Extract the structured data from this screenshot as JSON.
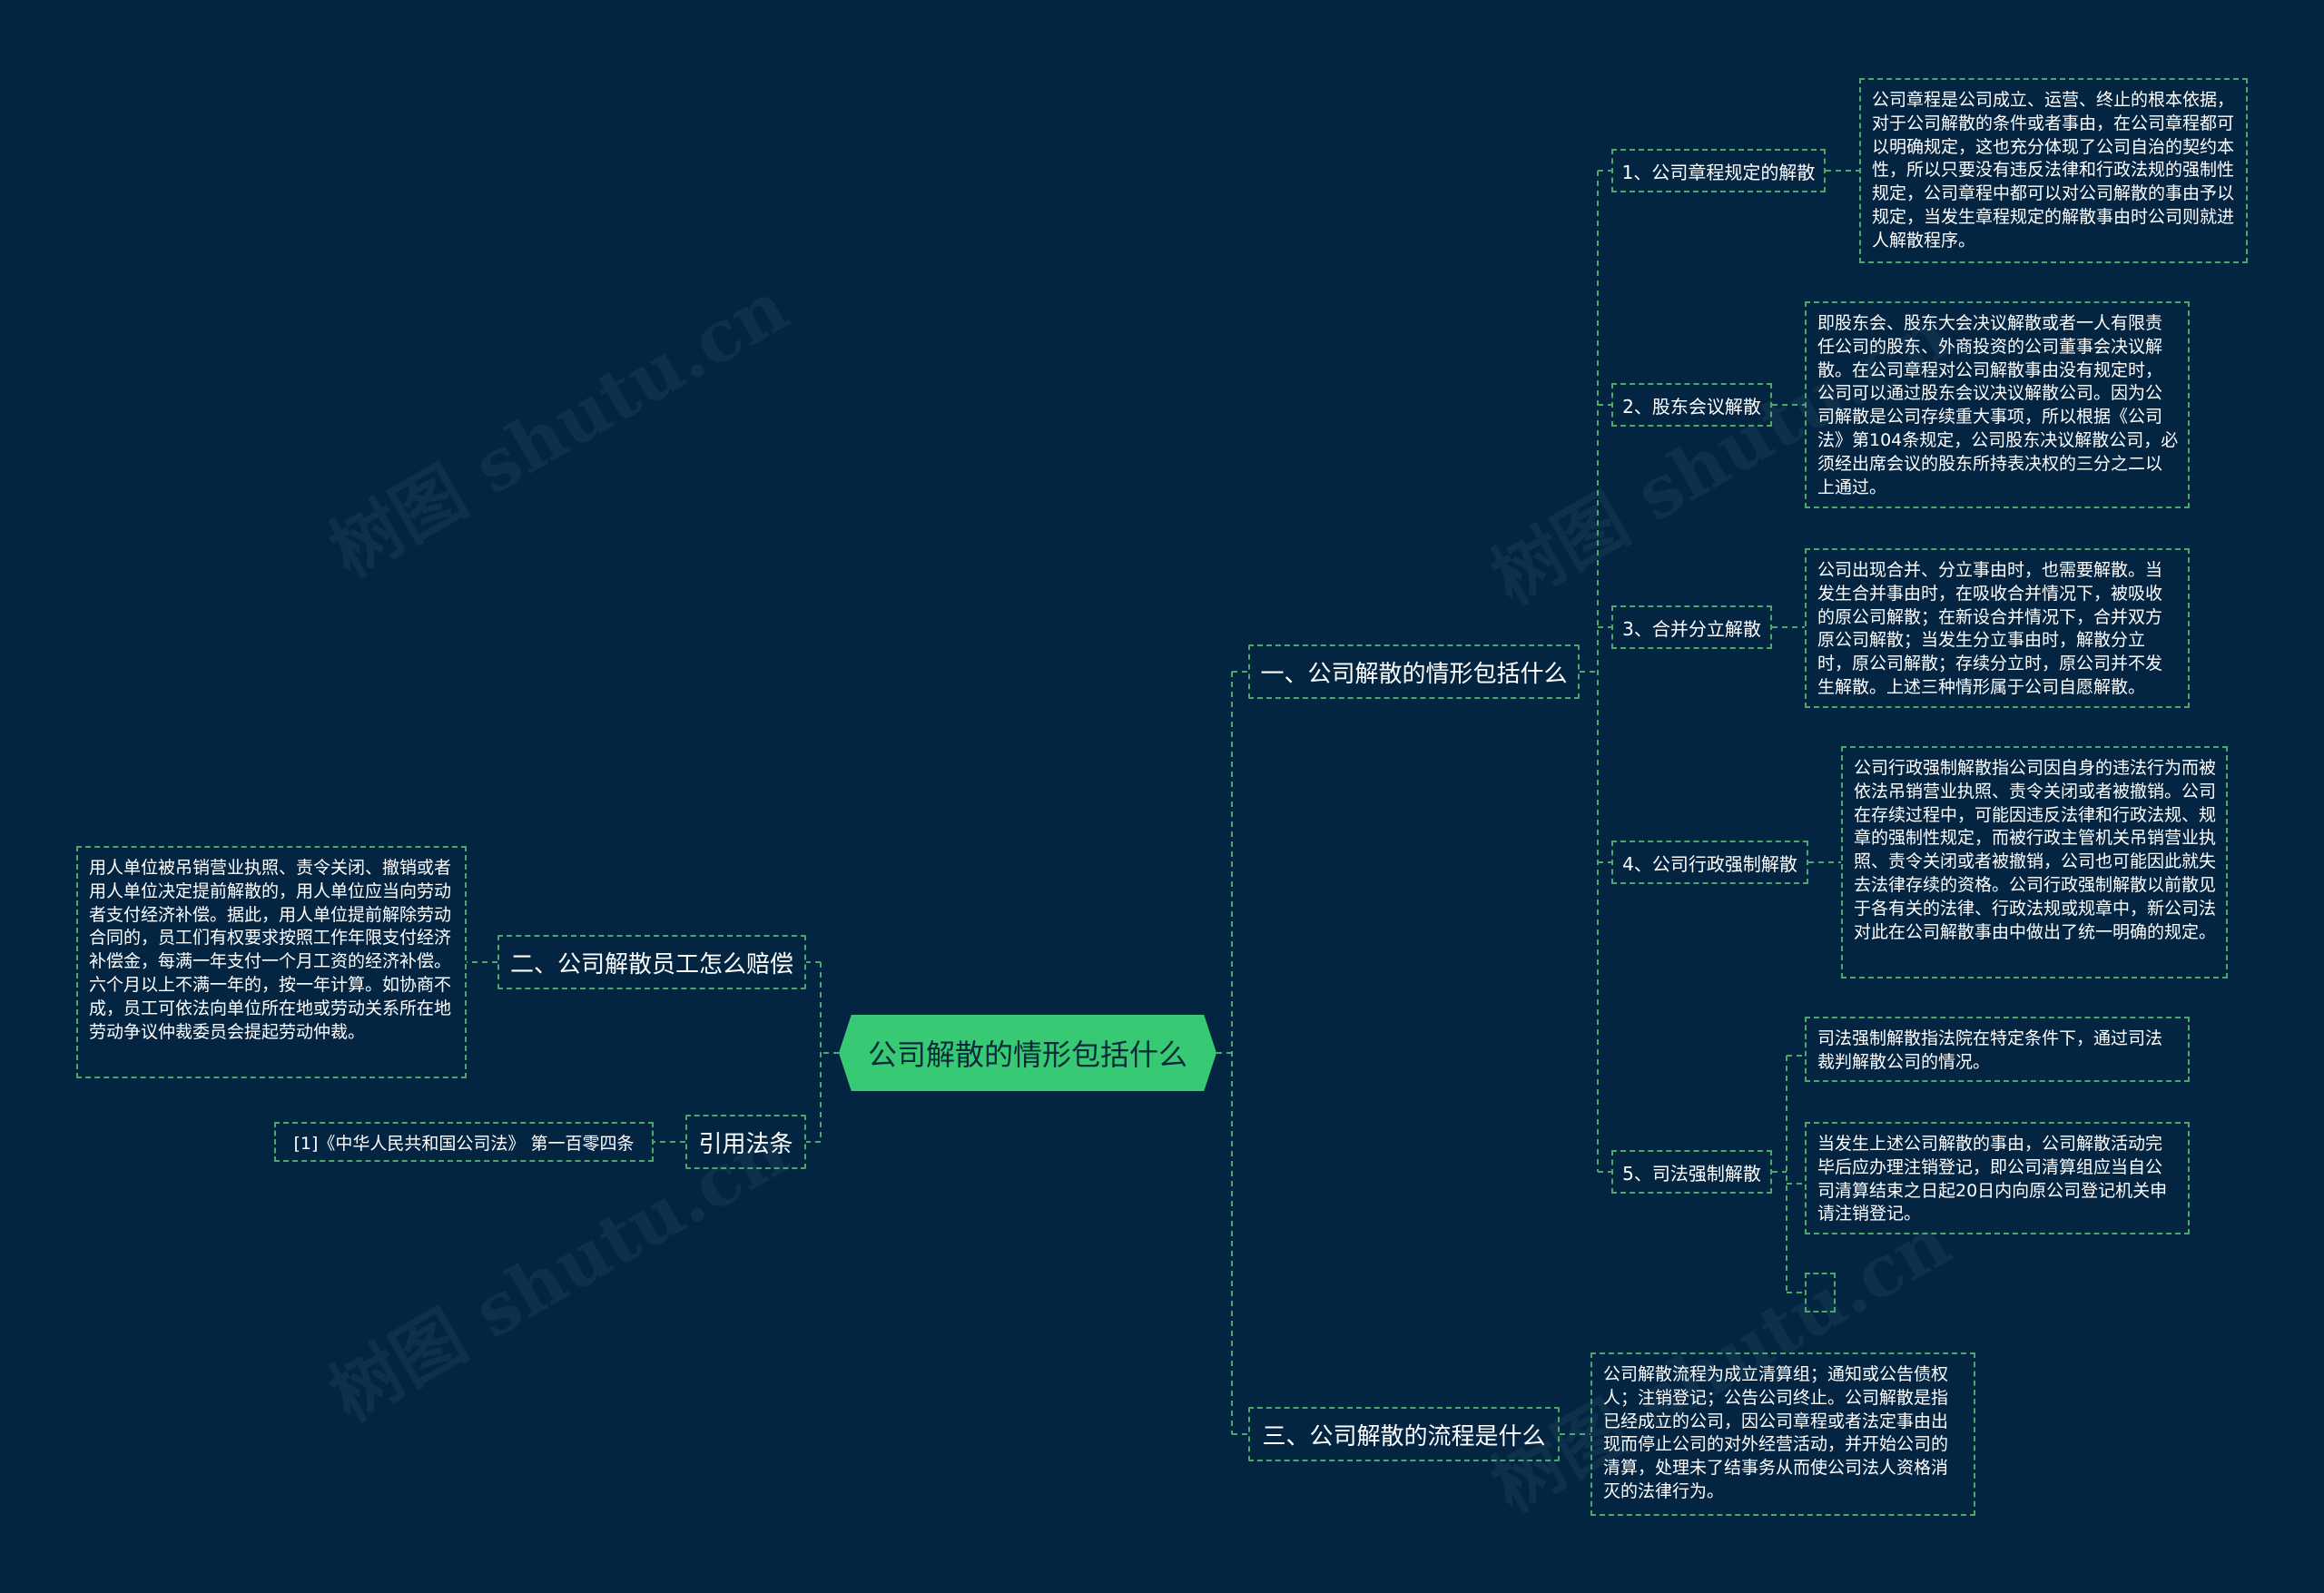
{
  "watermark": "树图 shutu.cn",
  "root": "公司解散的情形包括什么",
  "branch1": {
    "label": "一、公司解散的情形包括什么",
    "items": [
      {
        "label": "1、公司章程规定的解散",
        "detail": "公司章程是公司成立、运营、终止的根本依据，对于公司解散的条件或者事由，在公司章程都可以明确规定，这也充分体现了公司自治的契约本性，所以只要没有违反法律和行政法规的强制性规定，公司章程中都可以对公司解散的事由予以规定，当发生章程规定的解散事由时公司则就进人解散程序。"
      },
      {
        "label": "2、股东会议解散",
        "detail": "即股东会、股东大会决议解散或者一人有限责任公司的股东、外商投资的公司董事会决议解散。在公司章程对公司解散事由没有规定时，公司可以通过股东会议决议解散公司。因为公司解散是公司存续重大事项，所以根据《公司法》第104条规定，公司股东决议解散公司，必须经出席会议的股东所持表决权的三分之二以上通过。"
      },
      {
        "label": "3、合并分立解散",
        "detail": "公司出现合并、分立事由时，也需要解散。当发生合并事由时，在吸收合并情况下，被吸收的原公司解散；在新设合并情况下，合并双方原公司解散；当发生分立事由时，解散分立时，原公司解散；存续分立时，原公司并不发生解散。上述三种情形属于公司自愿解散。"
      },
      {
        "label": "4、公司行政强制解散",
        "detail": "公司行政强制解散指公司因自身的违法行为而被依法吊销营业执照、责令关闭或者被撤销。公司在存续过程中，可能因违反法律和行政法规、规章的强制性规定，而被行政主管机关吊销营业执照、责令关闭或者被撤销，公司也可能因此就失去法律存续的资格。公司行政强制解散以前散见于各有关的法律、行政法规或规章中，新公司法对此在公司解散事由中做出了统一明确的规定。"
      },
      {
        "label": "5、司法强制解散",
        "details": [
          "司法强制解散指法院在特定条件下，通过司法裁判解散公司的情况。",
          "当发生上述公司解散的事由，公司解散活动完毕后应办理注销登记，即公司清算组应当自公司清算结束之日起20日内向原公司登记机关申请注销登记。",
          ""
        ]
      }
    ]
  },
  "branch2": {
    "label": "二、公司解散员工怎么赔偿",
    "detail": "用人单位被吊销营业执照、责令关闭、撤销或者用人单位决定提前解散的，用人单位应当向劳动者支付经济补偿。据此，用人单位提前解除劳动合同的，员工们有权要求按照工作年限支付经济补偿金，每满一年支付一个月工资的经济补偿。六个月以上不满一年的，按一年计算。如协商不成，员工可依法向单位所在地或劳动关系所在地劳动争议仲裁委员会提起劳动仲裁。"
  },
  "branch3": {
    "label": "引用法条",
    "detail": "[1]《中华人民共和国公司法》 第一百零四条"
  },
  "branch4": {
    "label": "三、公司解散的流程是什么",
    "detail": "公司解散流程为成立清算组；通知或公告债权人；注销登记；公告公司终止。公司解散是指已经成立的公司，因公司章程或者法定事由出现而停止公司的对外经营活动，并开始公司的清算，处理未了结事务从而使公司法人资格消灭的法律行为。"
  }
}
